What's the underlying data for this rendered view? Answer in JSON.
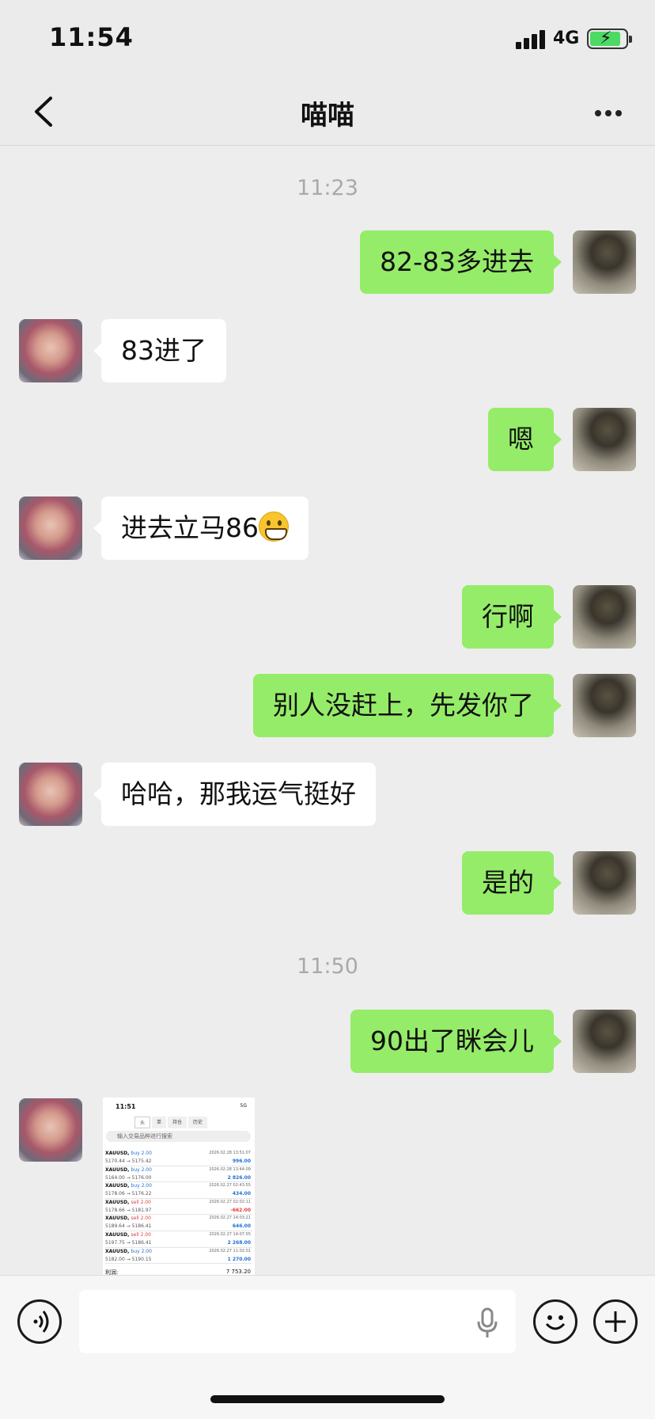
{
  "status_bar": {
    "time": "11:54",
    "network": "4G"
  },
  "header": {
    "title": "喵喵"
  },
  "timestamps": [
    "11:23",
    "11:50"
  ],
  "messages": [
    {
      "from": "me",
      "text": "82-83多进去"
    },
    {
      "from": "contact",
      "text": "83进了"
    },
    {
      "from": "me",
      "text": "嗯"
    },
    {
      "from": "contact",
      "text": "进去立马86",
      "emoji": "grinning-face-icon"
    },
    {
      "from": "me",
      "text": "行啊"
    },
    {
      "from": "me",
      "text": "别人没赶上，先发你了"
    },
    {
      "from": "contact",
      "text": "哈哈，那我运气挺好"
    },
    {
      "from": "me",
      "text": "是的"
    },
    {
      "from": "me",
      "text": "90出了眯会儿"
    },
    {
      "from": "contact",
      "type": "image",
      "description": "trade-history-screenshot"
    }
  ],
  "screenshot": {
    "time": "11:51",
    "status": "5G",
    "tabs": [
      "头",
      "单",
      "持仓",
      "历史"
    ],
    "search_placeholder": "输入交易品种进行搜索",
    "trades": [
      {
        "symbol": "XAUUSD,",
        "side": "buy 2.00",
        "prices": "5170.44 → 5175.42",
        "date": "2026.02.28 13:51:07",
        "profit": "996.00"
      },
      {
        "symbol": "XAUUSD,",
        "side": "buy 2.00",
        "prices": "5164.00 → 5176.00",
        "date": "2026.02.28 13:44:09",
        "profit": "2 826.00"
      },
      {
        "symbol": "XAUUSD,",
        "side": "buy 2.00",
        "prices": "5178.06 → 5176.22",
        "date": "2026.02.27 02:43:55",
        "profit": "434.00"
      },
      {
        "symbol": "XAUUSD,",
        "side": "sell 2.00",
        "prices": "5178.66 → 5181.97",
        "date": "2026.02.27 02:02:11",
        "profit": "-662.00"
      },
      {
        "symbol": "XAUUSD,",
        "side": "sell 2.00",
        "prices": "5189.64 → 5186.41",
        "date": "2026.02.27 14:03:21",
        "profit": "646.00"
      },
      {
        "symbol": "XAUUSD,",
        "side": "sell 2.00",
        "prices": "5197.75 → 5186.41",
        "date": "2026.02.27 14:07:55",
        "profit": "2 268.00"
      },
      {
        "symbol": "XAUUSD,",
        "side": "buy 2.00",
        "prices": "5182.00 → 5190.15",
        "date": "2026.02.27 11:02:01",
        "profit": "1 270.00"
      }
    ],
    "total_label": "利润:",
    "total_value": "7 753.20"
  },
  "colors": {
    "my_bubble": "#95ec69",
    "their_bubble": "#ffffff",
    "background": "#ededed"
  }
}
